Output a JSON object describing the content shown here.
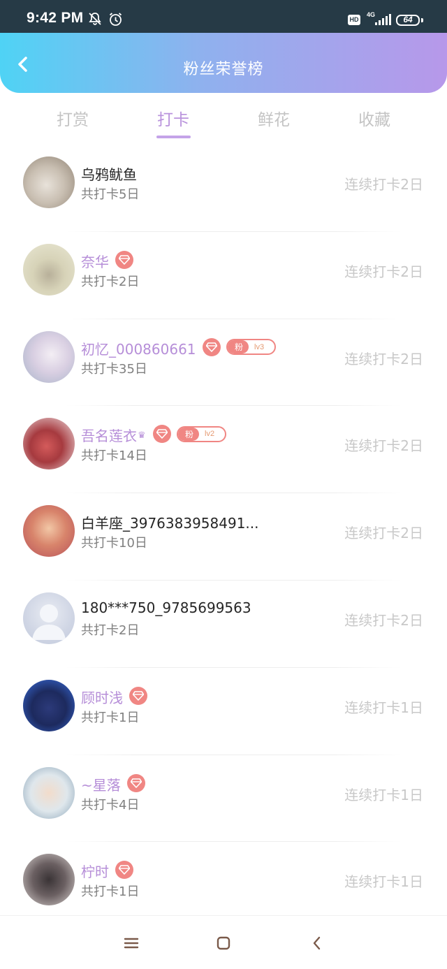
{
  "status": {
    "time": "9:42 PM",
    "network": "4G",
    "battery": "64",
    "hd": "HD"
  },
  "header": {
    "title": "粉丝荣誉榜"
  },
  "tabs": [
    {
      "label": "打赏",
      "active": false
    },
    {
      "label": "打卡",
      "active": true
    },
    {
      "label": "鲜花",
      "active": false
    },
    {
      "label": "收藏",
      "active": false
    }
  ],
  "fans": [
    {
      "name": "乌鸦鱿鱼",
      "total": "共打卡5日",
      "streak": "连续打卡2日",
      "vip": false,
      "gem": false,
      "fan_badge": null
    },
    {
      "name": "奈华",
      "total": "共打卡2日",
      "streak": "连续打卡2日",
      "vip": true,
      "gem": true,
      "fan_badge": null
    },
    {
      "name": "初忆_000860661",
      "total": "共打卡35日",
      "streak": "连续打卡2日",
      "vip": true,
      "gem": true,
      "fan_badge": {
        "label": "粉",
        "level": "lv3"
      }
    },
    {
      "name": "吾名莲衣",
      "total": "共打卡14日",
      "streak": "连续打卡2日",
      "vip": true,
      "gem": true,
      "crown": true,
      "fan_badge": {
        "label": "粉",
        "level": "lv2"
      }
    },
    {
      "name": "白羊座_3976383958491...",
      "total": "共打卡10日",
      "streak": "连续打卡2日",
      "vip": false,
      "gem": false,
      "fan_badge": null
    },
    {
      "name": "180***750_9785699563",
      "total": "共打卡2日",
      "streak": "连续打卡2日",
      "vip": false,
      "gem": false,
      "fan_badge": null
    },
    {
      "name": "顾时浅",
      "total": "共打卡1日",
      "streak": "连续打卡1日",
      "vip": true,
      "gem": true,
      "fan_badge": null
    },
    {
      "name": "~星落",
      "total": "共打卡4日",
      "streak": "连续打卡1日",
      "vip": true,
      "gem": true,
      "fan_badge": null
    },
    {
      "name": "柠时",
      "total": "共打卡1日",
      "streak": "连续打卡1日",
      "vip": true,
      "gem": true,
      "fan_badge": null
    }
  ],
  "colors": {
    "accent": "#b993dc",
    "gem": "#f08683",
    "header_start": "#4fd3f5",
    "header_end": "#b798ea"
  }
}
